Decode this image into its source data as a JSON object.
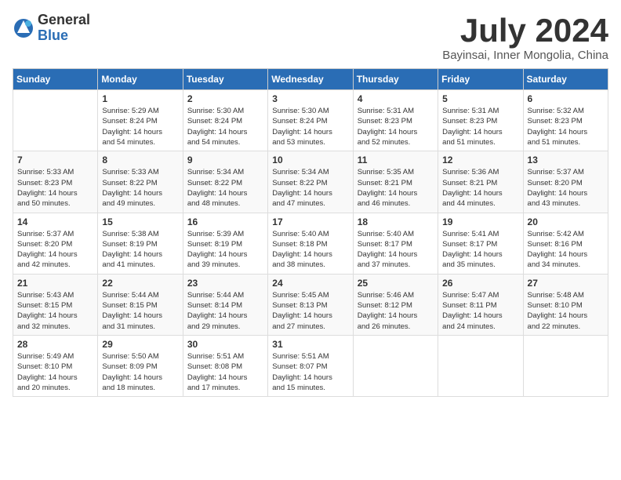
{
  "logo": {
    "general": "General",
    "blue": "Blue"
  },
  "title": "July 2024",
  "subtitle": "Bayinsai, Inner Mongolia, China",
  "header_days": [
    "Sunday",
    "Monday",
    "Tuesday",
    "Wednesday",
    "Thursday",
    "Friday",
    "Saturday"
  ],
  "weeks": [
    [
      {
        "day": "",
        "info": ""
      },
      {
        "day": "1",
        "info": "Sunrise: 5:29 AM\nSunset: 8:24 PM\nDaylight: 14 hours\nand 54 minutes."
      },
      {
        "day": "2",
        "info": "Sunrise: 5:30 AM\nSunset: 8:24 PM\nDaylight: 14 hours\nand 54 minutes."
      },
      {
        "day": "3",
        "info": "Sunrise: 5:30 AM\nSunset: 8:24 PM\nDaylight: 14 hours\nand 53 minutes."
      },
      {
        "day": "4",
        "info": "Sunrise: 5:31 AM\nSunset: 8:23 PM\nDaylight: 14 hours\nand 52 minutes."
      },
      {
        "day": "5",
        "info": "Sunrise: 5:31 AM\nSunset: 8:23 PM\nDaylight: 14 hours\nand 51 minutes."
      },
      {
        "day": "6",
        "info": "Sunrise: 5:32 AM\nSunset: 8:23 PM\nDaylight: 14 hours\nand 51 minutes."
      }
    ],
    [
      {
        "day": "7",
        "info": "Sunrise: 5:33 AM\nSunset: 8:23 PM\nDaylight: 14 hours\nand 50 minutes."
      },
      {
        "day": "8",
        "info": "Sunrise: 5:33 AM\nSunset: 8:22 PM\nDaylight: 14 hours\nand 49 minutes."
      },
      {
        "day": "9",
        "info": "Sunrise: 5:34 AM\nSunset: 8:22 PM\nDaylight: 14 hours\nand 48 minutes."
      },
      {
        "day": "10",
        "info": "Sunrise: 5:34 AM\nSunset: 8:22 PM\nDaylight: 14 hours\nand 47 minutes."
      },
      {
        "day": "11",
        "info": "Sunrise: 5:35 AM\nSunset: 8:21 PM\nDaylight: 14 hours\nand 46 minutes."
      },
      {
        "day": "12",
        "info": "Sunrise: 5:36 AM\nSunset: 8:21 PM\nDaylight: 14 hours\nand 44 minutes."
      },
      {
        "day": "13",
        "info": "Sunrise: 5:37 AM\nSunset: 8:20 PM\nDaylight: 14 hours\nand 43 minutes."
      }
    ],
    [
      {
        "day": "14",
        "info": "Sunrise: 5:37 AM\nSunset: 8:20 PM\nDaylight: 14 hours\nand 42 minutes."
      },
      {
        "day": "15",
        "info": "Sunrise: 5:38 AM\nSunset: 8:19 PM\nDaylight: 14 hours\nand 41 minutes."
      },
      {
        "day": "16",
        "info": "Sunrise: 5:39 AM\nSunset: 8:19 PM\nDaylight: 14 hours\nand 39 minutes."
      },
      {
        "day": "17",
        "info": "Sunrise: 5:40 AM\nSunset: 8:18 PM\nDaylight: 14 hours\nand 38 minutes."
      },
      {
        "day": "18",
        "info": "Sunrise: 5:40 AM\nSunset: 8:17 PM\nDaylight: 14 hours\nand 37 minutes."
      },
      {
        "day": "19",
        "info": "Sunrise: 5:41 AM\nSunset: 8:17 PM\nDaylight: 14 hours\nand 35 minutes."
      },
      {
        "day": "20",
        "info": "Sunrise: 5:42 AM\nSunset: 8:16 PM\nDaylight: 14 hours\nand 34 minutes."
      }
    ],
    [
      {
        "day": "21",
        "info": "Sunrise: 5:43 AM\nSunset: 8:15 PM\nDaylight: 14 hours\nand 32 minutes."
      },
      {
        "day": "22",
        "info": "Sunrise: 5:44 AM\nSunset: 8:15 PM\nDaylight: 14 hours\nand 31 minutes."
      },
      {
        "day": "23",
        "info": "Sunrise: 5:44 AM\nSunset: 8:14 PM\nDaylight: 14 hours\nand 29 minutes."
      },
      {
        "day": "24",
        "info": "Sunrise: 5:45 AM\nSunset: 8:13 PM\nDaylight: 14 hours\nand 27 minutes."
      },
      {
        "day": "25",
        "info": "Sunrise: 5:46 AM\nSunset: 8:12 PM\nDaylight: 14 hours\nand 26 minutes."
      },
      {
        "day": "26",
        "info": "Sunrise: 5:47 AM\nSunset: 8:11 PM\nDaylight: 14 hours\nand 24 minutes."
      },
      {
        "day": "27",
        "info": "Sunrise: 5:48 AM\nSunset: 8:10 PM\nDaylight: 14 hours\nand 22 minutes."
      }
    ],
    [
      {
        "day": "28",
        "info": "Sunrise: 5:49 AM\nSunset: 8:10 PM\nDaylight: 14 hours\nand 20 minutes."
      },
      {
        "day": "29",
        "info": "Sunrise: 5:50 AM\nSunset: 8:09 PM\nDaylight: 14 hours\nand 18 minutes."
      },
      {
        "day": "30",
        "info": "Sunrise: 5:51 AM\nSunset: 8:08 PM\nDaylight: 14 hours\nand 17 minutes."
      },
      {
        "day": "31",
        "info": "Sunrise: 5:51 AM\nSunset: 8:07 PM\nDaylight: 14 hours\nand 15 minutes."
      },
      {
        "day": "",
        "info": ""
      },
      {
        "day": "",
        "info": ""
      },
      {
        "day": "",
        "info": ""
      }
    ]
  ]
}
